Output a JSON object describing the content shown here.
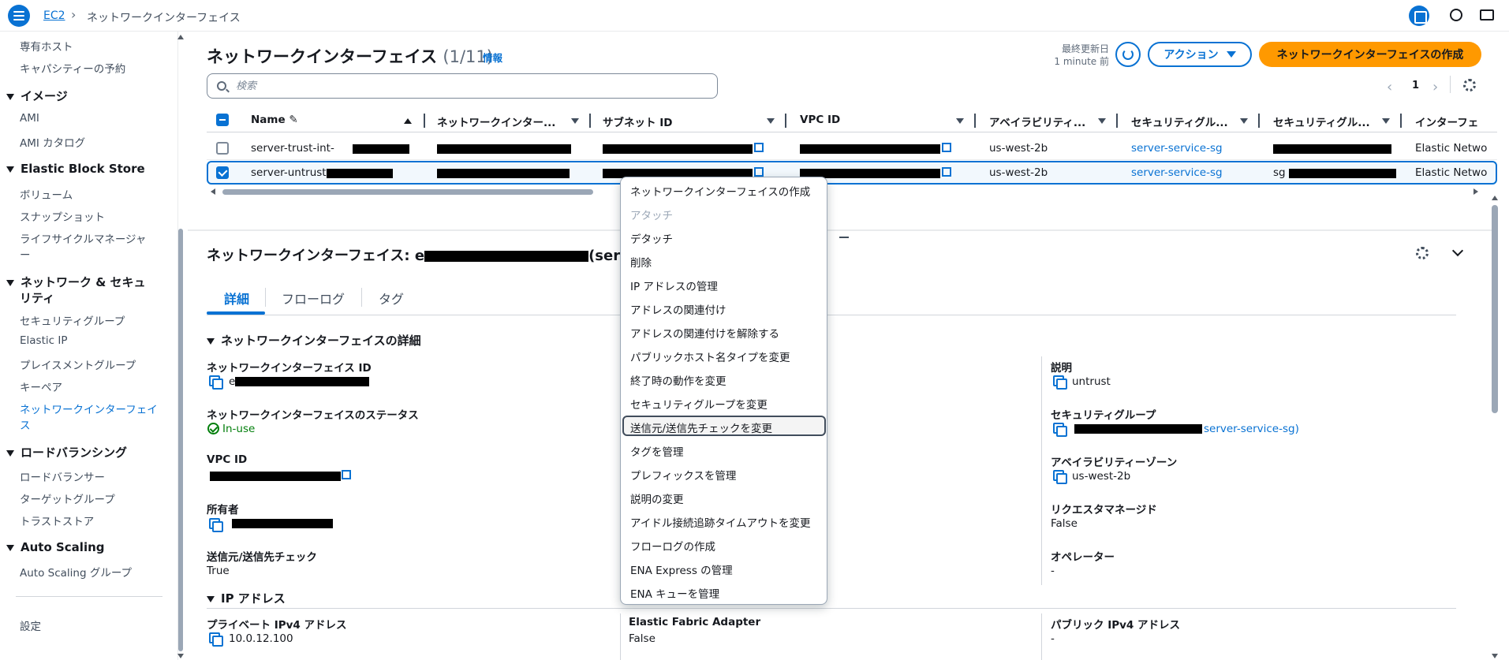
{
  "topbar": {
    "breadcrumb_root": "EC2",
    "breadcrumb_current": "ネットワークインターフェイス"
  },
  "sidebar": {
    "items_top": [
      "専有ホスト",
      "キャパシティーの予約"
    ],
    "groups": [
      {
        "title": "イメージ",
        "items": [
          "AMI",
          "AMI カタログ"
        ]
      },
      {
        "title": "Elastic Block Store",
        "items": [
          "ボリューム",
          "スナップショット",
          "ライフサイクルマネージャ",
          "ー"
        ]
      },
      {
        "title": "ネットワーク & セキュ",
        "title2": "リティ",
        "items": [
          "セキュリティグループ",
          "Elastic IP",
          "プレイスメントグループ",
          "キーペア",
          "ネットワークインターフェイ",
          "ス"
        ]
      },
      {
        "title": "ロードバランシング",
        "items": [
          "ロードバランサー",
          "ターゲットグループ",
          "トラストストア"
        ]
      },
      {
        "title": "Auto Scaling",
        "items": [
          "Auto Scaling グループ"
        ]
      }
    ],
    "settings": "設定"
  },
  "header": {
    "title": "ネットワークインターフェイス",
    "count": "(1/11)",
    "info": "情報",
    "updated_label": "最終更新日",
    "updated_value": "1 minute 前",
    "actions_label": "アクション",
    "create_label": "ネットワークインターフェイスの作成"
  },
  "search": {
    "placeholder": "検索",
    "value": ""
  },
  "pagination": {
    "current": "1"
  },
  "table": {
    "columns": [
      "Name",
      "ネットワークインター...",
      "サブネット ID",
      "VPC ID",
      "アベイラビリティ...",
      "セキュリティグル...",
      "セキュリティグル...",
      "インターフェ"
    ],
    "rows": [
      {
        "name": "server-trust-int-",
        "az": "us-west-2b",
        "sg": "server-service-sg",
        "type": "Elastic Netwo",
        "selected": false
      },
      {
        "name": "server-untrust-",
        "az": "us-west-2b",
        "sg": "server-service-sg",
        "sg_prefix": "sg",
        "type": "Elastic Netwo",
        "selected": true
      }
    ]
  },
  "details": {
    "title_prefix": "ネットワークインターフェイス: e",
    "title_suffix": "(server",
    "tabs": [
      "詳細",
      "フローログ",
      "タグ"
    ],
    "section_main": "ネットワークインターフェイスの詳細",
    "eni_id_label": "ネットワークインターフェイス ID",
    "eni_id_prefix": "e",
    "status_label": "ネットワークインターフェイスのステータス",
    "status_value": "In-use",
    "vpc_label": "VPC ID",
    "owner_label": "所有者",
    "srcdst_label": "送信元/送信先チェック",
    "srcdst_value": "True",
    "desc_label": "説明",
    "desc_value": "untrust",
    "sg_label": "セキュリティグループ",
    "sg_value_suffix": "server-service-sg)",
    "az_label": "アベイラビリティーゾーン",
    "az_value": "us-west-2b",
    "requester_label": "リクエスタマネージド",
    "requester_value": "False",
    "operator_label": "オペレーター",
    "operator_value": "-",
    "section_ip": "IP アドレス",
    "private_ip_label": "プライベート IPv4 アドレス",
    "private_ip_value": "10.0.12.100",
    "efa_label": "Elastic Fabric Adapter",
    "efa_value": "False",
    "public_ip_label": "パブリック IPv4 アドレス",
    "public_ip_value": "-"
  },
  "context_menu": {
    "items": [
      {
        "label": "ネットワークインターフェイスの作成",
        "disabled": false
      },
      {
        "label": "アタッチ",
        "disabled": true
      },
      {
        "label": "デタッチ",
        "disabled": false
      },
      {
        "label": "削除",
        "disabled": false
      },
      {
        "label": "IP アドレスの管理",
        "disabled": false
      },
      {
        "label": "アドレスの関連付け",
        "disabled": false
      },
      {
        "label": "アドレスの関連付けを解除する",
        "disabled": false
      },
      {
        "label": "パブリックホスト名タイプを変更",
        "disabled": false
      },
      {
        "label": "終了時の動作を変更",
        "disabled": false
      },
      {
        "label": "セキュリティグループを変更",
        "disabled": false
      },
      {
        "label": "送信元/送信先チェックを変更",
        "disabled": false,
        "highlighted": true
      },
      {
        "label": "タグを管理",
        "disabled": false
      },
      {
        "label": "プレフィックスを管理",
        "disabled": false
      },
      {
        "label": "説明の変更",
        "disabled": false
      },
      {
        "label": "アイドル接続追跡タイムアウトを変更",
        "disabled": false
      },
      {
        "label": "フローログの作成",
        "disabled": false
      },
      {
        "label": "ENA Express の管理",
        "disabled": false
      },
      {
        "label": "ENA キューを管理",
        "disabled": false
      }
    ]
  }
}
